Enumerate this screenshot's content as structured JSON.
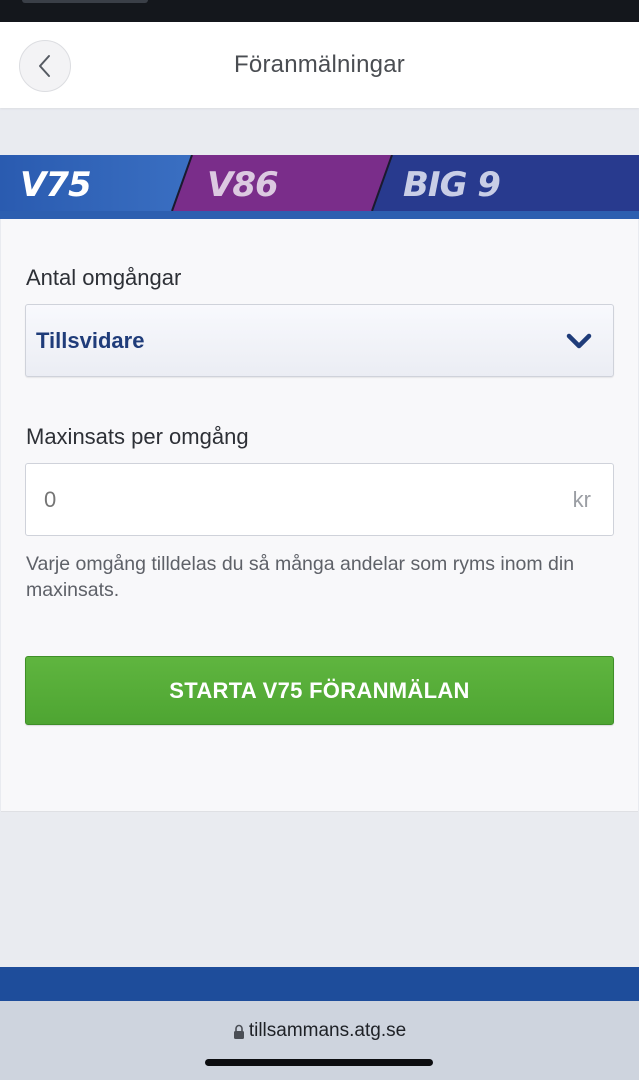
{
  "header": {
    "title": "Föranmälningar",
    "back_icon": "chevron-left-icon"
  },
  "game_tabs": [
    {
      "label": "V75",
      "color": "#2d5fb0",
      "text_color": "#ffffff",
      "active": true
    },
    {
      "label": "V86",
      "color": "#7a2d8a",
      "text_color": "#d9c6de",
      "active": false
    },
    {
      "label": "BIG 9",
      "color": "#283a8e",
      "text_color": "#c9cee6",
      "active": false
    }
  ],
  "form": {
    "rounds_label": "Antal omgångar",
    "rounds_value": "Tillsvidare",
    "max_stake_label": "Maxinsats per omgång",
    "max_stake_placeholder": "0",
    "max_stake_suffix": "kr",
    "help_text": "Varje omgång tilldelas du så många andelar som ryms inom din maxinsats.",
    "submit_label": "STARTA V75 FÖRANMÄLAN"
  },
  "browser": {
    "url": "tillsammans.atg.se"
  },
  "colors": {
    "accent_green": "#55ab37",
    "brand_blue": "#1e4d9b",
    "select_text": "#1f3c7a"
  }
}
